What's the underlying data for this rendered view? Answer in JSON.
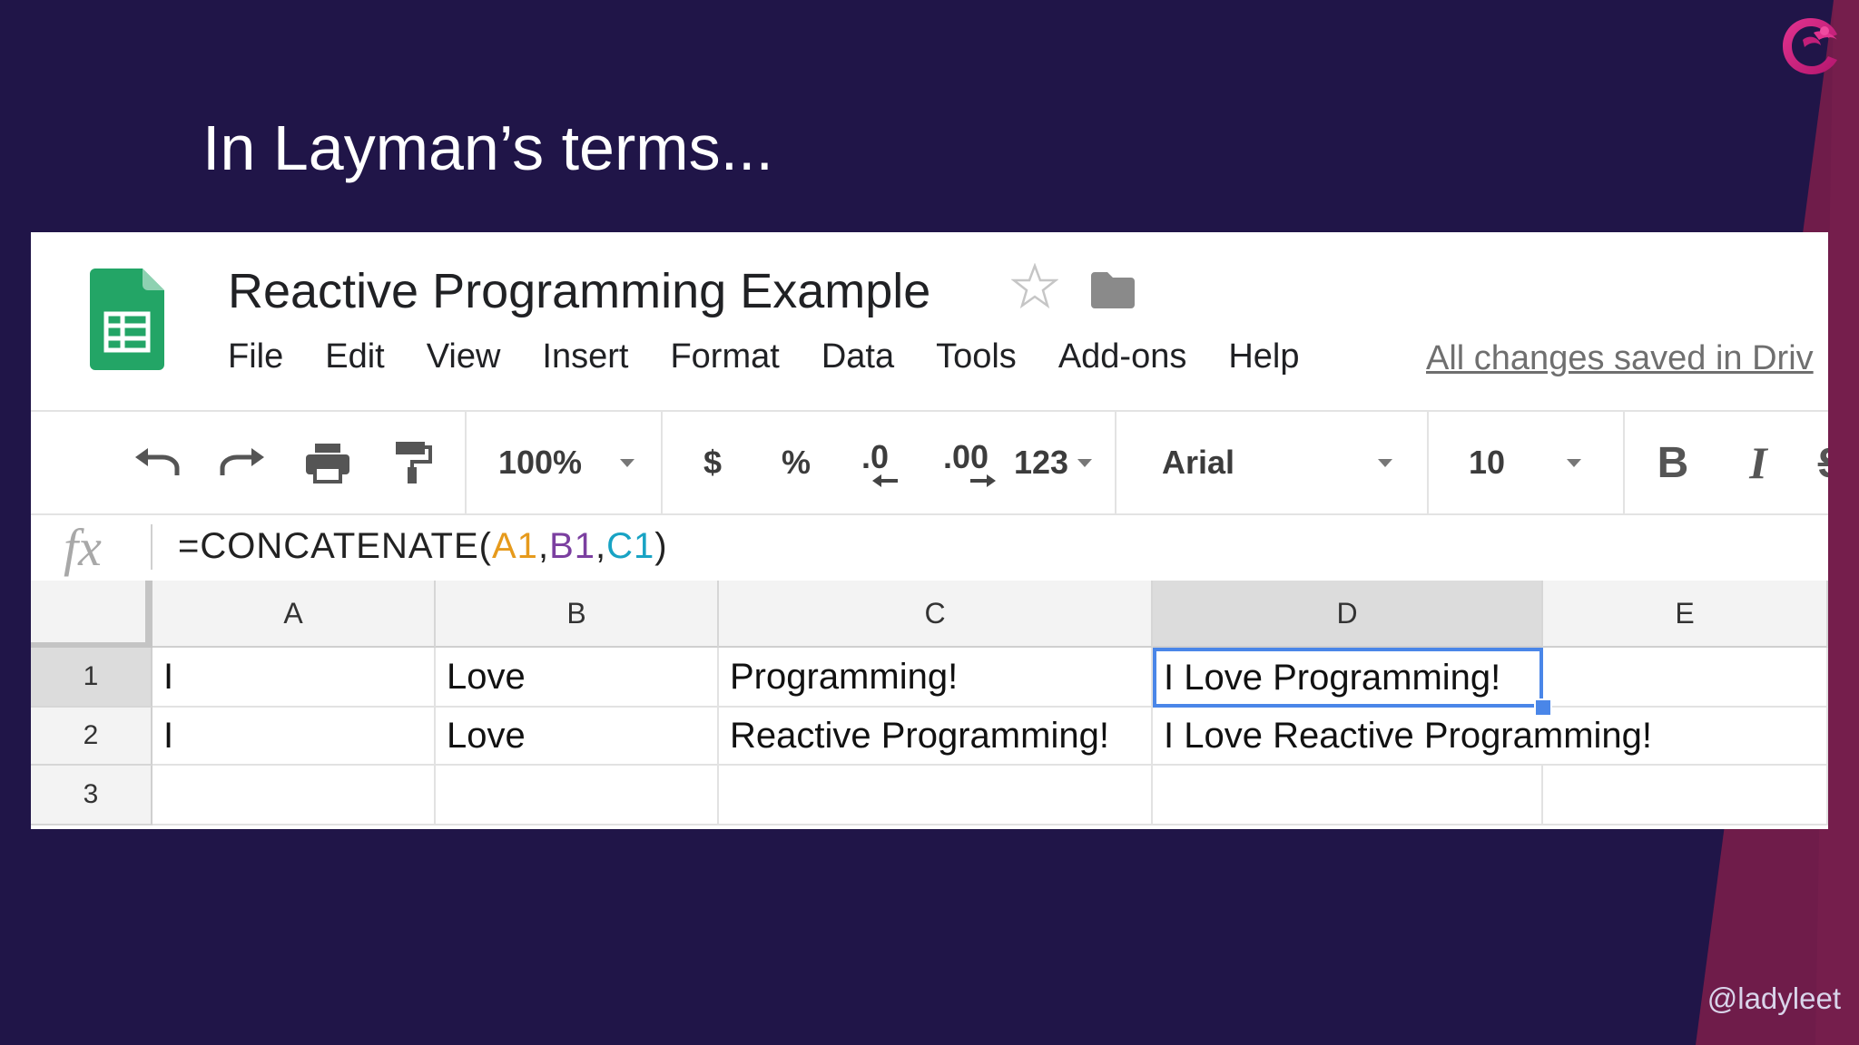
{
  "slide": {
    "title": "In Layman’s terms...",
    "handle": "@ladyleet"
  },
  "sheets": {
    "doc_title": "Reactive Programming Example",
    "menu": [
      "File",
      "Edit",
      "View",
      "Insert",
      "Format",
      "Data",
      "Tools",
      "Add-ons",
      "Help"
    ],
    "saved_status": "All changes saved in Driv",
    "toolbar": {
      "zoom": "100%",
      "currency": "$",
      "percent": "%",
      "dec_decrease": ".0",
      "dec_increase": ".00",
      "more_formats": "123",
      "font": "Arial",
      "font_size": "10",
      "bold": "B",
      "italic": "I",
      "strike": "S"
    },
    "formula_bar": {
      "fx": "fx",
      "prefix": "=CONCATENATE(",
      "ref1": "A1",
      "comma1": ",",
      "ref2": "B1",
      "comma2": ",",
      "ref3": "C1",
      "suffix": ")",
      "ref_colors": {
        "A1": "#e69a1c",
        "B1": "#7b3fa0",
        "C1": "#18a3c4"
      }
    },
    "columns": [
      "A",
      "B",
      "C",
      "D",
      "E"
    ],
    "rows": [
      "1",
      "2",
      "3"
    ],
    "cells": {
      "r1": [
        "I",
        "Love",
        "Programming!",
        "I Love Programming!",
        ""
      ],
      "r2": [
        "I",
        "Love",
        "Reactive Programming!",
        "I Love Reactive Programming!",
        ""
      ],
      "r3": [
        "",
        "",
        "",
        "",
        ""
      ]
    },
    "active_cell": "D1",
    "colors": {
      "slide_bg": "#201548",
      "stripe": "#7a1f4e",
      "sheets_green": "#23a566",
      "selection_blue": "#4a86e8"
    }
  }
}
